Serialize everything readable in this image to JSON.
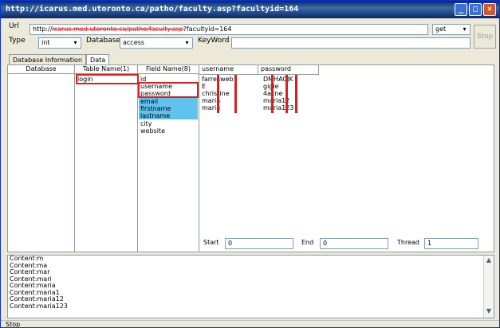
{
  "window": {
    "title": "http://icarus.med.utoronto.ca/patho/faculty.asp?facultyid=164"
  },
  "toolbar": {
    "url_label": "Url",
    "url_prefix": "http://",
    "url_redacted": "icarus.med.utoronto.ca/patho/faculty.asp",
    "url_suffix": "?facultyid=164",
    "method_value": "get",
    "stop_label": "Stop",
    "type_label": "Type",
    "type_value": "int",
    "database_label": "Database",
    "database_value": "access",
    "keyword_label": "KeyWord",
    "keyword_value": ""
  },
  "tabs": [
    {
      "label": "Database Information"
    },
    {
      "label": "Data"
    }
  ],
  "columns": {
    "database_header": "Database",
    "table_header": "Table Name(1)",
    "field_header": "Field Name(8)"
  },
  "tables": [
    "login"
  ],
  "fields": [
    "id",
    "username",
    "password",
    "email",
    "firstname",
    "lastname",
    "city",
    "website"
  ],
  "data_headers": [
    "username",
    "password"
  ],
  "data_rows": [
    {
      "username": "farresweb",
      "password": "DMHACJK"
    },
    {
      "username": "E",
      "password": "gigie"
    },
    {
      "username": "christine",
      "password": "4acne"
    },
    {
      "username": "maria",
      "password": "maria12"
    },
    {
      "username": "maria",
      "password": "maria123"
    }
  ],
  "bottom_controls": {
    "start_label": "Start",
    "start_value": "0",
    "end_label": "End",
    "end_value": "0",
    "thread_label": "Thread",
    "thread_value": "1"
  },
  "log_lines": [
    "Content:m",
    "Content:ma",
    "Content:mar",
    "Content:mari",
    "Content:maria",
    "Content:maria1",
    "Content:maria12",
    "Content:maria123"
  ],
  "status": {
    "text": "Stop"
  },
  "colors": {
    "highlight": "#5fc3ee",
    "annotation_red": "#d42020",
    "title_blue": "#0a246a"
  }
}
